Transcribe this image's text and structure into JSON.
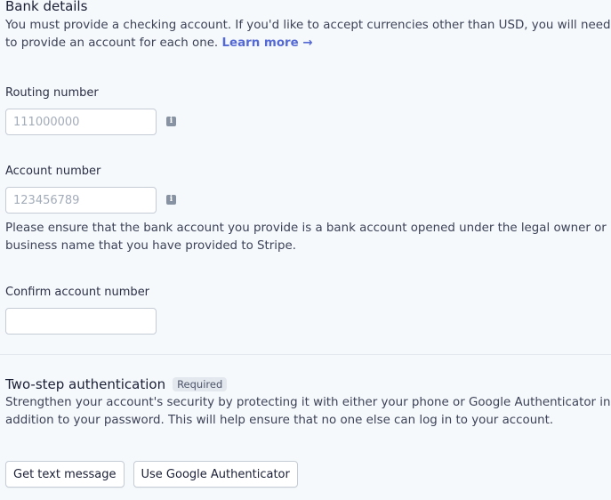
{
  "bank": {
    "title": "Bank details",
    "description": "You must provide a checking account. If you'd like to accept currencies other than USD, you will need to provide an account for each one. ",
    "learn_more": "Learn more →",
    "routing": {
      "label": "Routing number",
      "placeholder": "111000000",
      "value": ""
    },
    "account": {
      "label": "Account number",
      "placeholder": "123456789",
      "value": "",
      "note": "Please ensure that the bank account you provide is a bank account opened under the legal owner or business name that you have provided to Stripe."
    },
    "confirm": {
      "label": "Confirm account number",
      "placeholder": "",
      "value": ""
    }
  },
  "two_step": {
    "title": "Two-step authentication",
    "badge": "Required",
    "description": "Strengthen your account's security by protecting it with either your phone or Google Authenticator in addition to your password. This will help ensure that no one else can log in to your account.",
    "buttons": {
      "text_message": "Get text message",
      "google_auth": "Use Google Authenticator"
    }
  },
  "icons": {
    "info": "info-icon"
  }
}
